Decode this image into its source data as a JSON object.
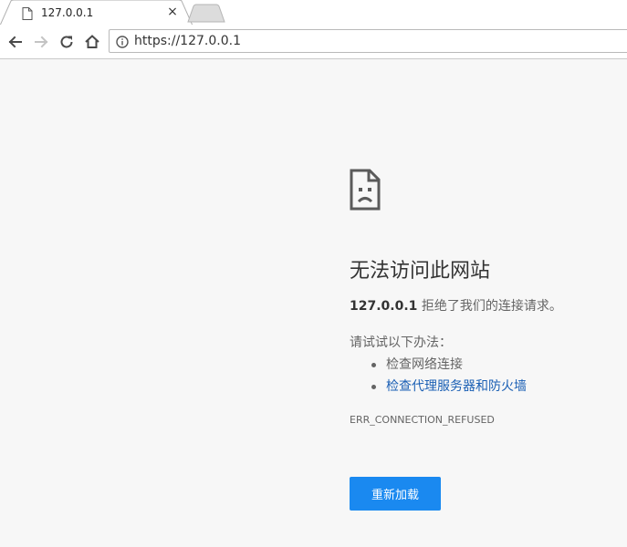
{
  "tab": {
    "title": "127.0.0.1",
    "close_glyph": "×",
    "favicon": "page-icon"
  },
  "toolbar": {
    "back_icon": "back-arrow-icon",
    "forward_icon": "forward-arrow-icon",
    "reload_icon": "reload-icon",
    "home_icon": "home-icon",
    "url": "https://127.0.0.1",
    "info_icon": "info-icon"
  },
  "error_page": {
    "icon": "sad-page-icon",
    "title": "无法访问此网站",
    "host": "127.0.0.1",
    "description_rest": " 拒绝了我们的连接请求。",
    "try_label": "请试试以下办法：",
    "suggestions": [
      {
        "label": "检查网络连接",
        "is_link": false
      },
      {
        "label": "检查代理服务器和防火墙",
        "is_link": true
      }
    ],
    "error_code": "ERR_CONNECTION_REFUSED",
    "reload_label": "重新加载"
  },
  "colors": {
    "page_background": "#f7f7f7",
    "button_blue": "#1a89f0",
    "link_blue": "#1a5fb4",
    "body_text": "#646464"
  }
}
